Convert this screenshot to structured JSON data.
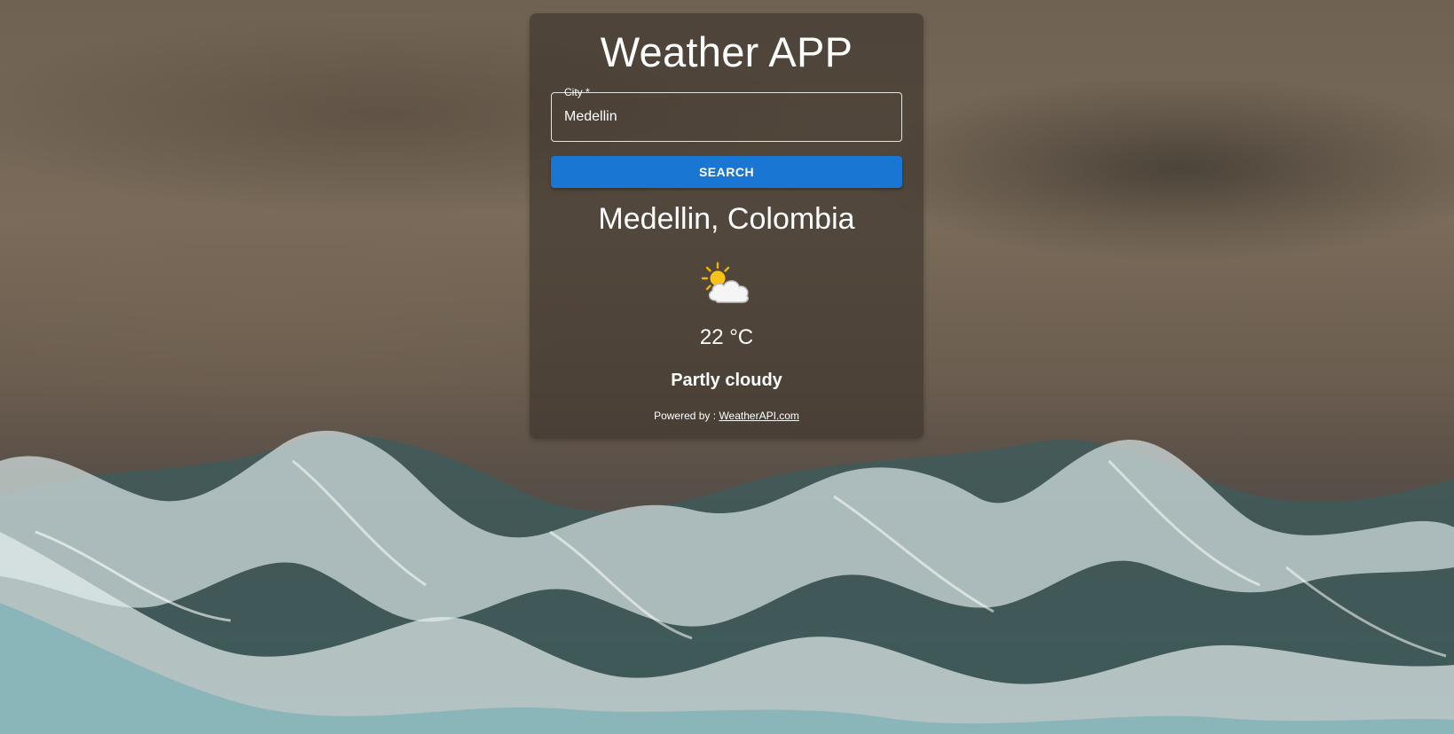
{
  "app": {
    "title": "Weather APP"
  },
  "search": {
    "label": "City *",
    "value": "Medellin",
    "button_label": "SEARCH"
  },
  "weather": {
    "location": "Medellin, Colombia",
    "icon": "partly-cloudy-icon",
    "temperature": "22 °C",
    "condition": "Partly cloudy"
  },
  "footer": {
    "powered_prefix": "Powered by : ",
    "provider_link": "WeatherAPI.com"
  },
  "colors": {
    "button": "#1976d2",
    "card_overlay": "rgba(58,50,42,0.62)",
    "text": "#ffffff"
  }
}
